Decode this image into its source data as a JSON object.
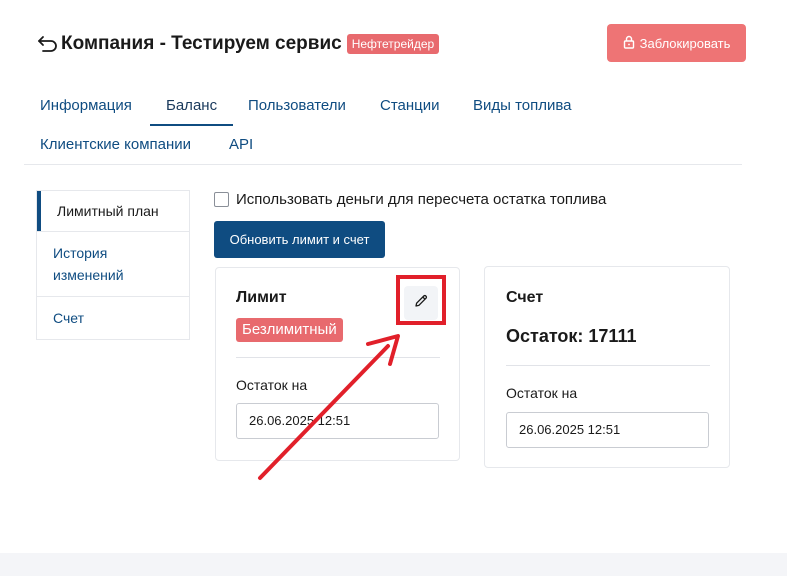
{
  "header": {
    "back_icon": "arrow-back-icon",
    "title": "Компания - Тестируем сервис",
    "tag": "Нефтетрейдер",
    "block_button": {
      "icon": "lock-icon",
      "label": "Заблокировать"
    }
  },
  "tabs": [
    {
      "label": "Информация",
      "active": false
    },
    {
      "label": "Баланс",
      "active": true
    },
    {
      "label": "Пользователи",
      "active": false
    },
    {
      "label": "Станции",
      "active": false
    },
    {
      "label": "Виды топлива",
      "active": false
    },
    {
      "label": "Клиентские компании",
      "active": false
    },
    {
      "label": "API",
      "active": false
    }
  ],
  "side_menu": [
    {
      "label": "Лимитный план",
      "active": true
    },
    {
      "label": "История изменений",
      "active": false
    },
    {
      "label": "Счет",
      "active": false
    }
  ],
  "checkbox": {
    "label": "Использовать деньги для пересчета остатка топлива",
    "checked": false
  },
  "update_button": {
    "label": "Обновить лимит и счет"
  },
  "limit_card": {
    "title": "Лимит",
    "edit_icon": "pencil-icon",
    "badge": "Безлимитный",
    "balance_label": "Остаток на",
    "date_value": "26.06.2025 12:51"
  },
  "account_card": {
    "title": "Счет",
    "balance": "Остаток: 17111",
    "balance_label": "Остаток на",
    "date_value": "26.06.2025 12:51"
  },
  "colors": {
    "primary": "#0f4c81",
    "danger": "#ee7475",
    "badge": "#e86a6e",
    "annotation": "#e1202a"
  }
}
